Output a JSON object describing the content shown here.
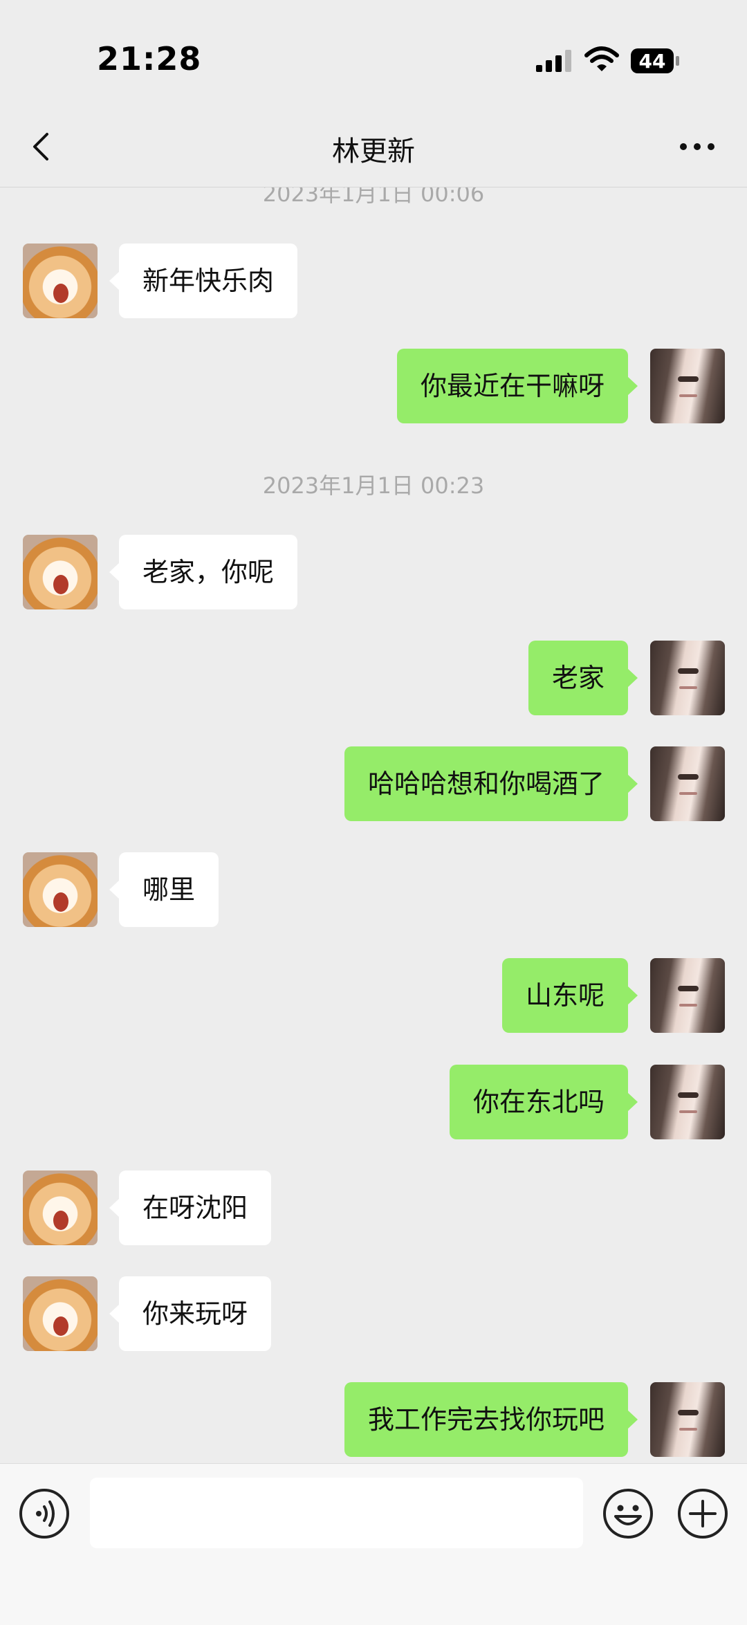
{
  "status_bar": {
    "time": "21:28",
    "battery": "44"
  },
  "nav": {
    "title": "林更新"
  },
  "messages": [
    {
      "type": "timestamp",
      "text": "2023年1月1日 00:06"
    },
    {
      "from": "them",
      "text": "新年快乐肉"
    },
    {
      "from": "me",
      "text": "你最近在干嘛呀"
    },
    {
      "type": "timestamp",
      "text": "2023年1月1日 00:23"
    },
    {
      "from": "them",
      "text": "老家，你呢"
    },
    {
      "from": "me",
      "text": "老家"
    },
    {
      "from": "me",
      "text": "哈哈哈想和你喝酒了"
    },
    {
      "from": "them",
      "text": "哪里"
    },
    {
      "from": "me",
      "text": "山东呢"
    },
    {
      "from": "me",
      "text": "你在东北吗"
    },
    {
      "from": "them",
      "text": "在呀沈阳"
    },
    {
      "from": "them",
      "text": "你来玩呀"
    },
    {
      "from": "me",
      "text": "我工作完去找你玩吧"
    }
  ],
  "input": {
    "value": ""
  },
  "icons": {
    "back": "chevron-left-icon",
    "more": "more-dots-icon",
    "voice": "voice-icon",
    "emoji": "emoji-icon",
    "plus": "plus-icon"
  },
  "colors": {
    "outgoing_bubble": "#95ec69",
    "incoming_bubble": "#ffffff",
    "background": "#ededed"
  }
}
